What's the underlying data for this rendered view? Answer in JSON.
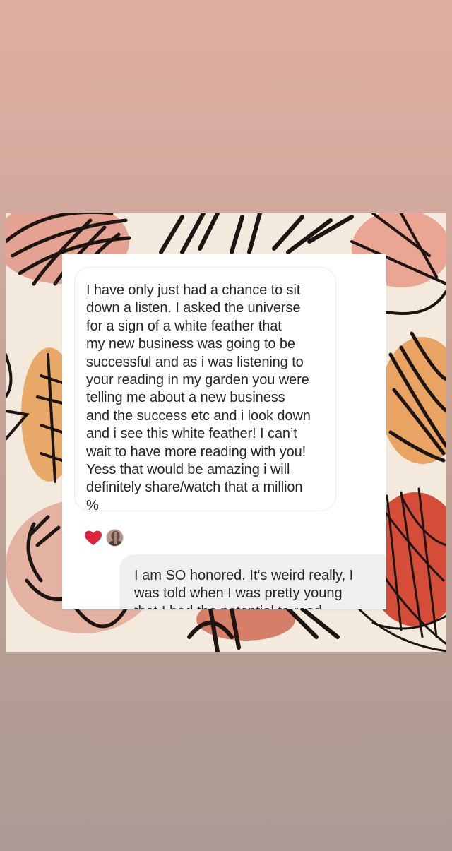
{
  "conversation": {
    "received_message": "I have only just had a chance to sit\ndown a listen. I asked the universe\nfor a sign of a white feather that\nmy new business was going to be\nsuccessful and as i was listening to\nyour reading in my garden you were\ntelling me about a new business\nand the success etc and i look down\nand i see this white feather! I can’t\nwait to have more reading with you!\nYess that would be amazing i will\ndefinitely share/watch that a million\n%",
    "reactions": {
      "heart_icon": "heart-icon",
      "reactor_avatar": "avatar-icon",
      "heart_color": "#e0233c"
    },
    "sent_message": "I am SO honored. It's weird really, I\nwas told when I was pretty young\nthat I had the potential to read"
  },
  "colors": {
    "sent_bubble": "#efefef",
    "received_bubble_border": "#ececec",
    "text": "#262626",
    "background_top": "#dfb0a2",
    "background_bottom": "#ab9a94"
  }
}
